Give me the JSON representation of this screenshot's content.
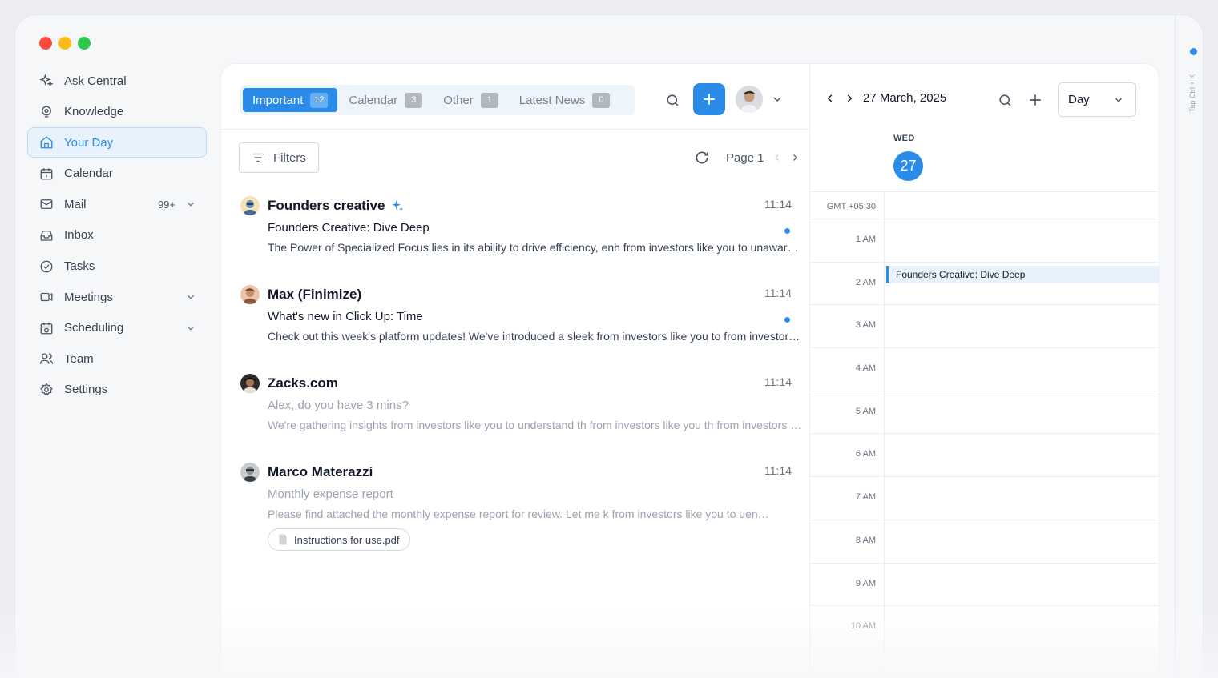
{
  "sidebar": {
    "items": [
      {
        "label": "Ask Central",
        "icon": "sparkle-icon"
      },
      {
        "label": "Knowledge",
        "icon": "lightbulb-icon"
      },
      {
        "label": "Your Day",
        "icon": "home-icon",
        "active": true
      },
      {
        "label": "Calendar",
        "icon": "calendar-icon"
      },
      {
        "label": "Mail",
        "icon": "mail-icon",
        "badge": "99+"
      },
      {
        "label": "Inbox",
        "icon": "inbox-icon"
      },
      {
        "label": "Tasks",
        "icon": "check-circle-icon"
      },
      {
        "label": "Meetings",
        "icon": "video-icon"
      },
      {
        "label": "Scheduling",
        "icon": "calendar-clock-icon"
      },
      {
        "label": "Team",
        "icon": "team-icon"
      },
      {
        "label": "Settings",
        "icon": "gear-icon"
      }
    ]
  },
  "tabs": [
    {
      "label": "Important",
      "count": "12"
    },
    {
      "label": "Calendar",
      "count": "3"
    },
    {
      "label": "Other",
      "count": "1"
    },
    {
      "label": "Latest News",
      "count": "0"
    }
  ],
  "toolbar": {
    "filters_label": "Filters",
    "page_label": "Page 1"
  },
  "mails": [
    {
      "sender": "Founders creative",
      "time": "11:14",
      "subject": "Founders Creative: Dive Deep",
      "preview": "The Power of Specialized Focus lies in its ability to drive efficiency, enh from investors like you to unaware the power of specialized focus"
    },
    {
      "sender": "Max (Finimize)",
      "time": "11:14",
      "subject": "What's new in Click Up: Time",
      "preview": "Check out this week's platform updates! We've introduced a sleek  from investors like you to from investors like you"
    },
    {
      "sender": "Zacks.com",
      "time": "11:14",
      "subject": "Alex, do you have 3 mins?",
      "preview": "We're gathering insights from investors like you to understand th  from investors like you  th  from investors like you"
    },
    {
      "sender": "Marco Materazzi",
      "time": "11:14",
      "subject": "Monthly expense report",
      "preview": "Please find attached the monthly expense report for review. Let me k from investors like you to uenderstand the report",
      "attachment": "Instructions for use.pdf"
    }
  ],
  "calendar": {
    "date_label": "27 March, 2025",
    "view": "Day",
    "weekday": "WED",
    "day": "27",
    "timezone": "GMT +05:30",
    "hours": [
      "1 AM",
      "2 AM",
      "3 AM",
      "4 AM",
      "5 AM",
      "6 AM",
      "7 AM",
      "8 AM",
      "9 AM",
      "10 AM"
    ],
    "event": "Founders Creative: Dive Deep"
  },
  "hint": "Tap Ctrl + K",
  "colors": {
    "accent": "#2b8be9"
  }
}
